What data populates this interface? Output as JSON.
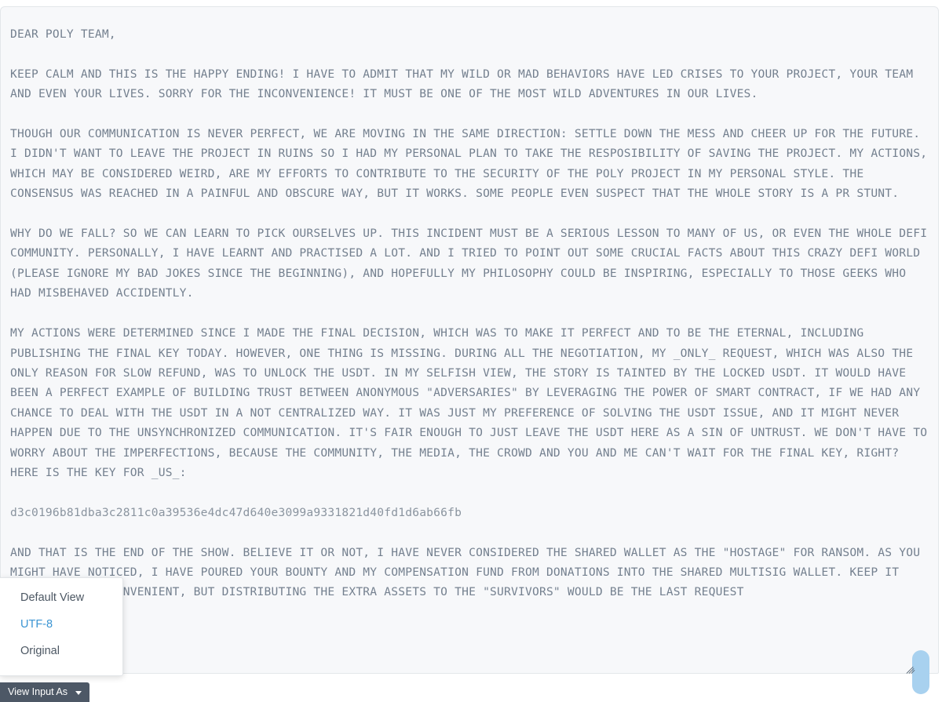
{
  "viewer": {
    "message_paragraphs": [
      "DEAR POLY TEAM,",
      "KEEP CALM AND THIS IS THE HAPPY ENDING! I HAVE TO ADMIT THAT MY WILD OR MAD BEHAVIORS HAVE LED CRISES TO YOUR PROJECT, YOUR TEAM AND EVEN YOUR LIVES. SORRY FOR THE INCONVENIENCE! IT MUST BE ONE OF THE MOST WILD ADVENTURES IN OUR LIVES.",
      "THOUGH OUR COMMUNICATION IS NEVER PERFECT, WE ARE MOVING IN THE SAME DIRECTION: SETTLE DOWN THE MESS AND CHEER UP FOR THE FUTURE. I DIDN'T WANT TO LEAVE THE PROJECT IN RUINS SO I HAD MY PERSONAL PLAN TO TAKE THE RESPOSIBILITY OF SAVING THE PROJECT. MY ACTIONS, WHICH MAY BE CONSIDERED WEIRD, ARE MY EFFORTS TO CONTRIBUTE TO THE SECURITY OF THE POLY PROJECT IN MY PERSONAL STYLE. THE CONSENSUS WAS REACHED IN A PAINFUL AND OBSCURE WAY, BUT IT WORKS. SOME PEOPLE EVEN SUSPECT THAT THE WHOLE STORY IS A PR STUNT.",
      "WHY DO WE FALL? SO WE CAN LEARN TO PICK OURSELVES UP. THIS INCIDENT MUST BE A SERIOUS LESSON TO MANY OF US, OR EVEN THE WHOLE DEFI COMMUNITY. PERSONALLY, I HAVE LEARNT AND PRACTISED A LOT. AND I TRIED TO POINT OUT SOME CRUCIAL FACTS ABOUT THIS CRAZY DEFI WORLD (PLEASE IGNORE MY BAD JOKES SINCE THE BEGINNING), AND HOPEFULLY MY PHILOSOPHY COULD BE INSPIRING, ESPECIALLY TO THOSE GEEKS WHO HAD MISBEHAVED ACCIDENTLY.",
      "MY ACTIONS WERE DETERMINED SINCE I MADE THE FINAL DECISION, WHICH WAS TO MAKE IT PERFECT AND TO BE THE ETERNAL, INCLUDING PUBLISHING THE FINAL KEY TODAY. HOWEVER, ONE THING IS MISSING. DURING ALL THE NEGOTIATION, MY _ONLY_ REQUEST, WHICH WAS ALSO THE ONLY REASON FOR SLOW REFUND, WAS TO UNLOCK THE USDT. IN MY SELFISH VIEW, THE STORY IS TAINTED BY THE LOCKED USDT. IT WOULD HAVE BEEN A PERFECT EXAMPLE OF BUILDING TRUST BETWEEN ANONYMOUS \"ADVERSARIES\" BY LEVERAGING THE POWER OF SMART CONTRACT, IF WE HAD ANY CHANCE TO DEAL WITH THE USDT IN A NOT CENTRALIZED WAY. IT WAS JUST MY PREFERENCE OF SOLVING THE USDT ISSUE, AND IT MIGHT NEVER HAPPEN DUE TO THE UNSYNCHRONIZED COMMUNICATION. IT'S FAIR ENOUGH TO JUST LEAVE THE USDT HERE AS A SIN OF UNTRUST. WE DON'T HAVE TO WORRY ABOUT THE IMPERFECTIONS, BECAUSE THE COMMUNITY, THE MEDIA, THE CROWD AND YOU AND ME CAN'T WAIT FOR THE FINAL KEY, RIGHT? HERE IS THE KEY FOR _US_:"
    ],
    "final_key": "d3c0196b81dba3c2811c0a39536e4dc47d640e3099a9331821d40fd1d6ab66fb",
    "closing_paragraph": "AND THAT IS THE END OF THE SHOW. BELIEVE IT OR NOT, I HAVE NEVER CONSIDERED THE SHARED WALLET AS THE \"HOSTAGE\" FOR RANSOM. AS YOU MIGHT HAVE NOTICED, I HAVE POURED YOUR BOUNTY AND MY COMPENSATION FUND FROM DONATIONS INTO THE SHARED MULTISIG WALLET. KEEP IT THERE IF IT'S CONVENIENT, BUT DISTRIBUTING THE EXTRA ASSETS TO THE \"SURVIVORS\" WOULD BE THE LAST REQUEST"
  },
  "dropdown": {
    "items": [
      {
        "label": "Default View",
        "selected": false
      },
      {
        "label": "UTF-8",
        "selected": true
      },
      {
        "label": "Original",
        "selected": false
      }
    ]
  },
  "toolbar": {
    "view_input_as_label": "View Input As",
    "caret_icon": "chevron-down-icon"
  },
  "colors": {
    "accent_blue": "#3b95d3",
    "text_muted": "#74808f",
    "button_bg": "#4d5866",
    "handle_blue": "#a8d1ef",
    "panel_bg": "#f7f8fa"
  }
}
